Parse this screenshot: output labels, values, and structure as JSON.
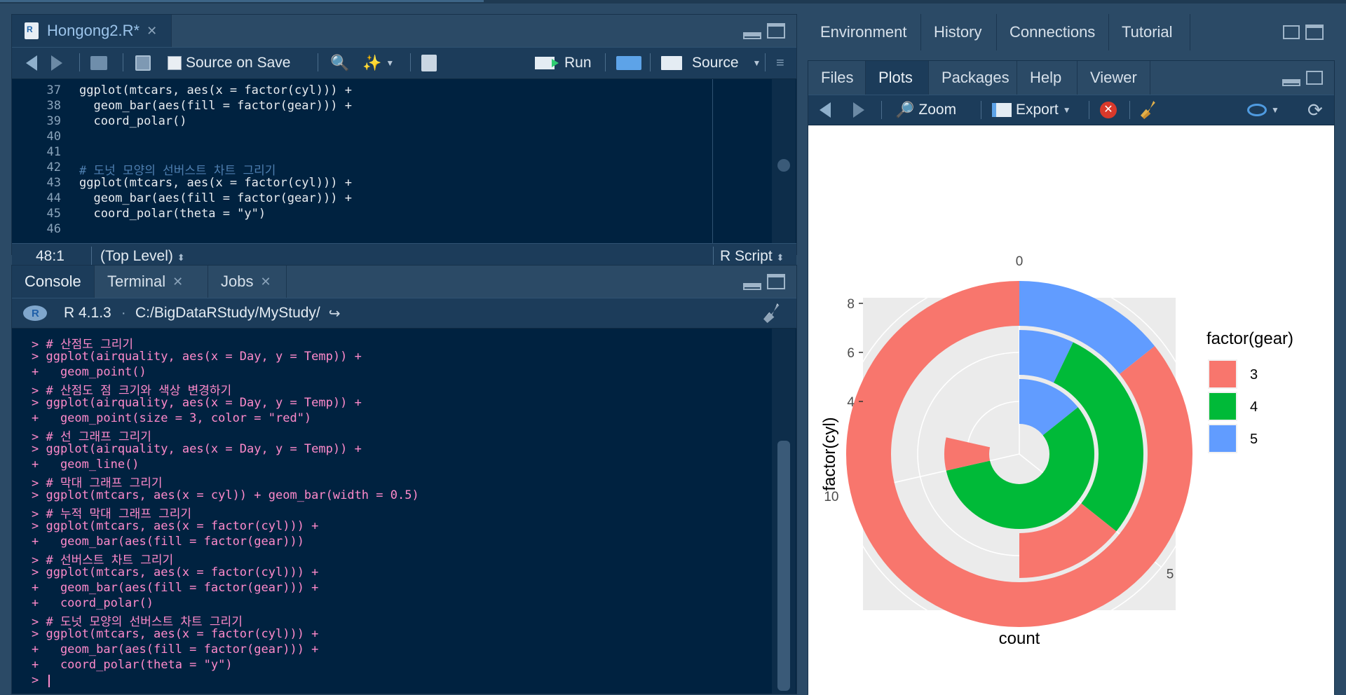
{
  "editor": {
    "file_tab": "Hongong2.R*",
    "source_on_save": "Source on Save",
    "run": "Run",
    "source": "Source",
    "line_numbers": [
      "37",
      "38",
      "39",
      "40",
      "41",
      "42",
      "43",
      "44",
      "45",
      "46"
    ],
    "code_lines": [
      "ggplot(mtcars, aes(x = factor(cyl))) +",
      "  geom_bar(aes(fill = factor(gear))) +",
      "  coord_polar()",
      "",
      "",
      "# 도넛 모양의 선버스트 차트 그리기",
      "ggplot(mtcars, aes(x = factor(cyl))) +",
      "  geom_bar(aes(fill = factor(gear))) +",
      "  coord_polar(theta = \"y\")",
      ""
    ],
    "cursor_position": "48:1",
    "scope": "(Top Level)",
    "file_type": "R Script"
  },
  "console": {
    "tabs": [
      "Console",
      "Terminal",
      "Jobs"
    ],
    "r_version": "R 4.1.3",
    "working_dir": "C:/BigDataRStudy/MyStudy/",
    "lines": [
      "> # 산점도 그리기",
      "> ggplot(airquality, aes(x = Day, y = Temp)) +",
      "+   geom_point()",
      "> # 산점도 점 크기와 색상 변경하기",
      "> ggplot(airquality, aes(x = Day, y = Temp)) +",
      "+   geom_point(size = 3, color = \"red\")",
      "> # 선 그래프 그리기",
      "> ggplot(airquality, aes(x = Day, y = Temp)) +",
      "+   geom_line()",
      "> # 막대 그래프 그리기",
      "> ggplot(mtcars, aes(x = cyl)) + geom_bar(width = 0.5)",
      "> # 누적 막대 그래프 그리기",
      "> ggplot(mtcars, aes(x = factor(cyl))) +",
      "+   geom_bar(aes(fill = factor(gear)))",
      "> # 선버스트 차트 그리기",
      "> ggplot(mtcars, aes(x = factor(cyl))) +",
      "+   geom_bar(aes(fill = factor(gear))) +",
      "+   coord_polar()",
      "> # 도넛 모양의 선버스트 차트 그리기",
      "> ggplot(mtcars, aes(x = factor(cyl))) +",
      "+   geom_bar(aes(fill = factor(gear))) +",
      "+   coord_polar(theta = \"y\")",
      "> "
    ]
  },
  "env_pane": {
    "tabs": [
      "Environment",
      "History",
      "Connections",
      "Tutorial"
    ]
  },
  "files_pane": {
    "tabs": [
      "Files",
      "Plots",
      "Packages",
      "Help",
      "Viewer"
    ],
    "zoom": "Zoom",
    "export": "Export"
  },
  "colors": {
    "gear3": "#F8766D",
    "gear4": "#00BA38",
    "gear5": "#619CFF",
    "panel_bg": "#EBEBEB"
  },
  "chart_data": {
    "type": "pie",
    "subtype": "donut (coord_polar theta = y, stacked bars)",
    "xlabel": "count",
    "ylabel": "factor(cyl)",
    "legend_title": "factor(gear)",
    "legend_position": "right",
    "radial_ticks": [
      "4",
      "6",
      "8"
    ],
    "angular_ticks": [
      "0",
      "5",
      "10"
    ],
    "categories": [
      "4",
      "6",
      "8"
    ],
    "series": [
      {
        "name": "3",
        "values": [
          1,
          2,
          12
        ]
      },
      {
        "name": "4",
        "values": [
          8,
          4,
          0
        ]
      },
      {
        "name": "5",
        "values": [
          2,
          1,
          2
        ]
      }
    ],
    "angular_range": [
      0,
      14
    ]
  }
}
